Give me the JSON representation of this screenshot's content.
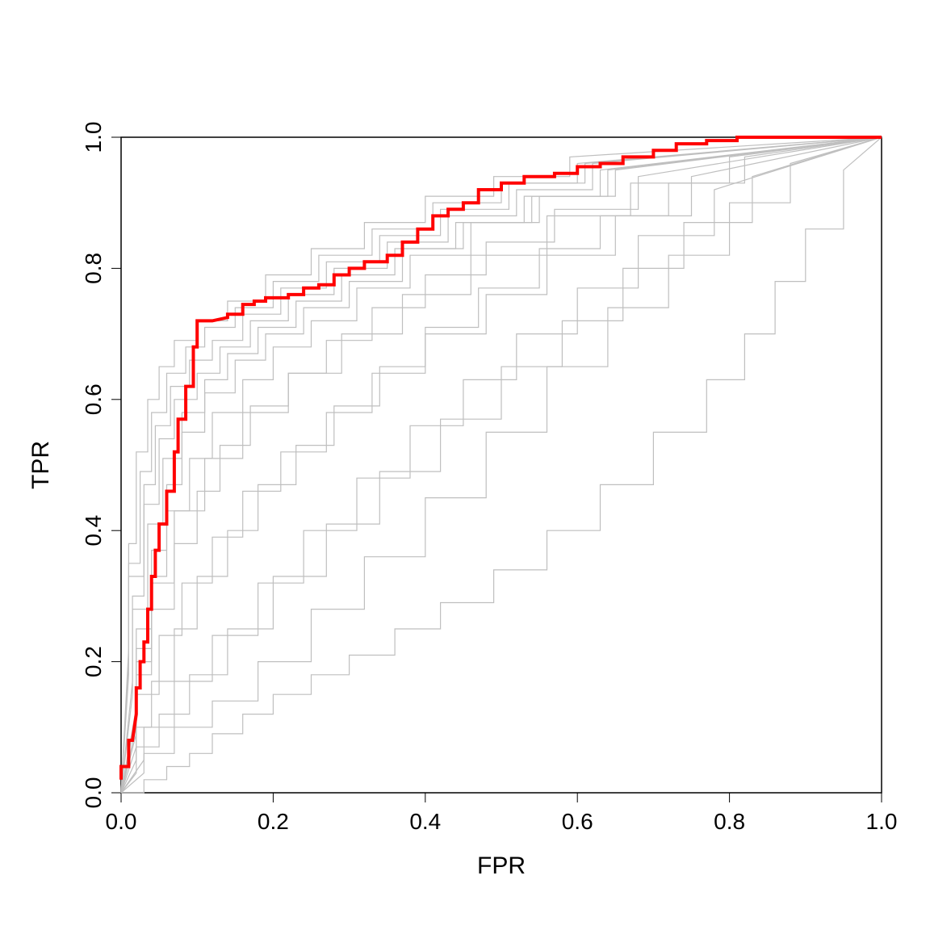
{
  "chart_data": {
    "type": "line",
    "title": "",
    "xlabel": "FPR",
    "ylabel": "TPR",
    "xlim": [
      0.0,
      1.0
    ],
    "ylim": [
      0.0,
      1.0
    ],
    "x_ticks": [
      0.0,
      0.2,
      0.4,
      0.6,
      0.8,
      1.0
    ],
    "y_ticks": [
      0.0,
      0.2,
      0.4,
      0.6,
      0.8,
      1.0
    ],
    "series": [
      {
        "name": "main",
        "color": "#ff0000",
        "lwd": 4,
        "x": [
          0.0,
          0.0,
          0.01,
          0.01,
          0.015,
          0.02,
          0.02,
          0.025,
          0.025,
          0.03,
          0.03,
          0.035,
          0.035,
          0.04,
          0.04,
          0.045,
          0.045,
          0.05,
          0.05,
          0.06,
          0.06,
          0.07,
          0.07,
          0.075,
          0.075,
          0.085,
          0.085,
          0.095,
          0.095,
          0.1,
          0.1,
          0.12,
          0.12,
          0.14,
          0.14,
          0.16,
          0.16,
          0.175,
          0.175,
          0.19,
          0.19,
          0.22,
          0.22,
          0.24,
          0.24,
          0.26,
          0.26,
          0.28,
          0.28,
          0.3,
          0.3,
          0.32,
          0.32,
          0.35,
          0.35,
          0.37,
          0.37,
          0.39,
          0.39,
          0.41,
          0.41,
          0.43,
          0.43,
          0.45,
          0.45,
          0.47,
          0.47,
          0.5,
          0.5,
          0.53,
          0.53,
          0.57,
          0.57,
          0.6,
          0.6,
          0.63,
          0.63,
          0.66,
          0.66,
          0.7,
          0.7,
          0.73,
          0.73,
          0.77,
          0.77,
          0.81,
          0.81,
          1.0
        ],
        "y": [
          0.02,
          0.04,
          0.04,
          0.08,
          0.08,
          0.12,
          0.16,
          0.16,
          0.2,
          0.2,
          0.23,
          0.23,
          0.28,
          0.28,
          0.33,
          0.33,
          0.37,
          0.37,
          0.41,
          0.41,
          0.46,
          0.46,
          0.52,
          0.52,
          0.57,
          0.57,
          0.62,
          0.62,
          0.68,
          0.68,
          0.72,
          0.72,
          0.72,
          0.725,
          0.73,
          0.73,
          0.745,
          0.745,
          0.75,
          0.75,
          0.755,
          0.755,
          0.76,
          0.76,
          0.77,
          0.77,
          0.775,
          0.775,
          0.79,
          0.79,
          0.8,
          0.8,
          0.81,
          0.81,
          0.82,
          0.82,
          0.84,
          0.84,
          0.86,
          0.86,
          0.88,
          0.88,
          0.89,
          0.89,
          0.9,
          0.9,
          0.92,
          0.92,
          0.93,
          0.93,
          0.94,
          0.94,
          0.945,
          0.945,
          0.955,
          0.955,
          0.96,
          0.96,
          0.97,
          0.97,
          0.98,
          0.98,
          0.99,
          0.99,
          0.995,
          0.995,
          1.0,
          1.0
        ]
      },
      {
        "name": "gray-1",
        "color": "#bfbfbf",
        "lwd": 1,
        "x": [
          0.0,
          0.03,
          0.03,
          0.06,
          0.06,
          0.09,
          0.09,
          0.12,
          0.12,
          0.16,
          0.16,
          0.2,
          0.2,
          0.25,
          0.25,
          0.3,
          0.3,
          0.36,
          0.36,
          0.42,
          0.42,
          0.49,
          0.49,
          0.56,
          0.56,
          0.63,
          0.63,
          0.7,
          0.7,
          0.77,
          0.77,
          0.82,
          0.82,
          0.86,
          0.86,
          0.9,
          0.9,
          0.95,
          0.95,
          1.0
        ],
        "y": [
          0.0,
          0.0,
          0.02,
          0.02,
          0.04,
          0.04,
          0.06,
          0.06,
          0.09,
          0.09,
          0.12,
          0.12,
          0.15,
          0.15,
          0.18,
          0.18,
          0.21,
          0.21,
          0.25,
          0.25,
          0.29,
          0.29,
          0.34,
          0.34,
          0.4,
          0.4,
          0.47,
          0.47,
          0.55,
          0.55,
          0.63,
          0.63,
          0.7,
          0.7,
          0.78,
          0.78,
          0.86,
          0.86,
          0.95,
          1.0
        ]
      },
      {
        "name": "gray-2",
        "color": "#bfbfbf",
        "lwd": 1,
        "x": [
          0.0,
          0.03,
          0.03,
          0.07,
          0.07,
          0.12,
          0.12,
          0.18,
          0.18,
          0.25,
          0.25,
          0.32,
          0.32,
          0.4,
          0.4,
          0.48,
          0.48,
          0.56,
          0.56,
          0.64,
          0.64,
          0.72,
          0.72,
          0.8,
          0.8,
          0.88,
          0.88,
          1.0
        ],
        "y": [
          0.0,
          0.03,
          0.06,
          0.06,
          0.1,
          0.1,
          0.14,
          0.14,
          0.2,
          0.2,
          0.28,
          0.28,
          0.36,
          0.36,
          0.45,
          0.45,
          0.55,
          0.55,
          0.65,
          0.65,
          0.74,
          0.74,
          0.82,
          0.82,
          0.9,
          0.9,
          0.96,
          1.0
        ]
      },
      {
        "name": "gray-3",
        "color": "#bfbfbf",
        "lwd": 1,
        "x": [
          0.0,
          0.02,
          0.02,
          0.04,
          0.04,
          0.07,
          0.07,
          0.1,
          0.1,
          0.14,
          0.14,
          0.18,
          0.18,
          0.23,
          0.23,
          0.28,
          0.28,
          0.34,
          0.34,
          0.4,
          0.4,
          0.47,
          0.47,
          0.55,
          0.55,
          0.63,
          0.63,
          0.72,
          0.72,
          0.82,
          0.82,
          1.0
        ],
        "y": [
          0.0,
          0.05,
          0.1,
          0.1,
          0.17,
          0.17,
          0.25,
          0.25,
          0.33,
          0.33,
          0.4,
          0.4,
          0.47,
          0.47,
          0.53,
          0.53,
          0.59,
          0.59,
          0.65,
          0.65,
          0.71,
          0.71,
          0.77,
          0.77,
          0.83,
          0.83,
          0.88,
          0.88,
          0.93,
          0.93,
          0.97,
          1.0
        ]
      },
      {
        "name": "gray-4",
        "color": "#bfbfbf",
        "lwd": 1,
        "x": [
          0.0,
          0.02,
          0.02,
          0.05,
          0.05,
          0.08,
          0.08,
          0.12,
          0.12,
          0.16,
          0.16,
          0.21,
          0.21,
          0.27,
          0.27,
          0.33,
          0.33,
          0.4,
          0.4,
          0.48,
          0.48,
          0.56,
          0.56,
          0.65,
          0.65,
          0.75,
          0.75,
          1.0
        ],
        "y": [
          0.0,
          0.07,
          0.15,
          0.15,
          0.24,
          0.24,
          0.32,
          0.32,
          0.39,
          0.39,
          0.46,
          0.46,
          0.52,
          0.52,
          0.58,
          0.58,
          0.64,
          0.64,
          0.7,
          0.7,
          0.76,
          0.76,
          0.82,
          0.82,
          0.88,
          0.88,
          0.94,
          1.0
        ]
      },
      {
        "name": "gray-5",
        "color": "#bfbfbf",
        "lwd": 1,
        "x": [
          0.0,
          0.02,
          0.02,
          0.04,
          0.04,
          0.07,
          0.07,
          0.1,
          0.1,
          0.13,
          0.13,
          0.17,
          0.17,
          0.22,
          0.22,
          0.27,
          0.27,
          0.33,
          0.33,
          0.4,
          0.4,
          0.48,
          0.48,
          0.57,
          0.57,
          0.68,
          0.68,
          1.0
        ],
        "y": [
          0.0,
          0.09,
          0.18,
          0.18,
          0.28,
          0.28,
          0.38,
          0.38,
          0.46,
          0.46,
          0.53,
          0.53,
          0.59,
          0.59,
          0.64,
          0.64,
          0.69,
          0.69,
          0.74,
          0.74,
          0.79,
          0.79,
          0.84,
          0.84,
          0.89,
          0.89,
          0.94,
          1.0
        ]
      },
      {
        "name": "gray-6",
        "color": "#bfbfbf",
        "lwd": 1,
        "x": [
          0.0,
          0.02,
          0.02,
          0.04,
          0.04,
          0.06,
          0.06,
          0.09,
          0.09,
          0.12,
          0.12,
          0.16,
          0.16,
          0.2,
          0.2,
          0.25,
          0.25,
          0.31,
          0.31,
          0.38,
          0.38,
          0.46,
          0.46,
          0.55,
          0.55,
          0.65,
          0.65,
          1.0
        ],
        "y": [
          0.0,
          0.12,
          0.22,
          0.22,
          0.33,
          0.33,
          0.43,
          0.43,
          0.51,
          0.51,
          0.58,
          0.58,
          0.63,
          0.63,
          0.68,
          0.68,
          0.72,
          0.72,
          0.77,
          0.77,
          0.82,
          0.82,
          0.87,
          0.87,
          0.91,
          0.91,
          0.95,
          1.0
        ]
      },
      {
        "name": "gray-7",
        "color": "#bfbfbf",
        "lwd": 1,
        "x": [
          0.0,
          0.02,
          0.02,
          0.04,
          0.04,
          0.06,
          0.06,
          0.08,
          0.08,
          0.11,
          0.11,
          0.15,
          0.15,
          0.19,
          0.19,
          0.24,
          0.24,
          0.3,
          0.3,
          0.37,
          0.37,
          0.45,
          0.45,
          0.54,
          0.54,
          0.64,
          0.64,
          1.0
        ],
        "y": [
          0.0,
          0.13,
          0.25,
          0.25,
          0.37,
          0.37,
          0.47,
          0.47,
          0.55,
          0.55,
          0.61,
          0.61,
          0.66,
          0.66,
          0.7,
          0.7,
          0.74,
          0.74,
          0.78,
          0.78,
          0.83,
          0.83,
          0.87,
          0.87,
          0.91,
          0.91,
          0.95,
          1.0
        ]
      },
      {
        "name": "gray-8",
        "color": "#bfbfbf",
        "lwd": 1,
        "x": [
          0.0,
          0.015,
          0.015,
          0.035,
          0.035,
          0.055,
          0.055,
          0.08,
          0.08,
          0.11,
          0.11,
          0.14,
          0.14,
          0.18,
          0.18,
          0.23,
          0.23,
          0.29,
          0.29,
          0.36,
          0.36,
          0.44,
          0.44,
          0.53,
          0.53,
          0.63,
          0.63,
          1.0
        ],
        "y": [
          0.0,
          0.15,
          0.28,
          0.28,
          0.41,
          0.41,
          0.51,
          0.51,
          0.58,
          0.58,
          0.63,
          0.63,
          0.67,
          0.67,
          0.71,
          0.71,
          0.75,
          0.75,
          0.79,
          0.79,
          0.83,
          0.83,
          0.87,
          0.87,
          0.91,
          0.91,
          0.95,
          1.0
        ]
      },
      {
        "name": "gray-9",
        "color": "#bfbfbf",
        "lwd": 1,
        "x": [
          0.0,
          0.015,
          0.015,
          0.03,
          0.03,
          0.05,
          0.05,
          0.07,
          0.07,
          0.1,
          0.1,
          0.13,
          0.13,
          0.17,
          0.17,
          0.22,
          0.22,
          0.28,
          0.28,
          0.35,
          0.35,
          0.43,
          0.43,
          0.52,
          0.52,
          0.62,
          0.62,
          1.0
        ],
        "y": [
          0.0,
          0.17,
          0.3,
          0.3,
          0.44,
          0.44,
          0.54,
          0.54,
          0.6,
          0.6,
          0.64,
          0.64,
          0.68,
          0.68,
          0.72,
          0.72,
          0.76,
          0.76,
          0.8,
          0.8,
          0.84,
          0.84,
          0.88,
          0.88,
          0.92,
          0.92,
          0.96,
          1.0
        ]
      },
      {
        "name": "gray-10",
        "color": "#bfbfbf",
        "lwd": 1,
        "x": [
          0.0,
          0.01,
          0.01,
          0.03,
          0.03,
          0.045,
          0.045,
          0.065,
          0.065,
          0.09,
          0.09,
          0.12,
          0.12,
          0.16,
          0.16,
          0.21,
          0.21,
          0.27,
          0.27,
          0.34,
          0.34,
          0.42,
          0.42,
          0.51,
          0.51,
          0.61,
          0.61,
          1.0
        ],
        "y": [
          0.0,
          0.18,
          0.33,
          0.33,
          0.47,
          0.47,
          0.56,
          0.56,
          0.62,
          0.62,
          0.66,
          0.66,
          0.69,
          0.69,
          0.73,
          0.73,
          0.77,
          0.77,
          0.81,
          0.81,
          0.85,
          0.85,
          0.89,
          0.89,
          0.93,
          0.93,
          0.96,
          1.0
        ]
      },
      {
        "name": "gray-low-1",
        "color": "#bfbfbf",
        "lwd": 1,
        "x": [
          0.0,
          0.02,
          0.02,
          0.05,
          0.05,
          0.09,
          0.09,
          0.14,
          0.14,
          0.2,
          0.2,
          0.27,
          0.27,
          0.34,
          0.34,
          0.42,
          0.42,
          0.5,
          0.5,
          0.58,
          0.58,
          0.66,
          0.66,
          0.74,
          0.74,
          0.83,
          0.83,
          1.0
        ],
        "y": [
          0.0,
          0.03,
          0.07,
          0.07,
          0.12,
          0.12,
          0.18,
          0.18,
          0.25,
          0.25,
          0.33,
          0.33,
          0.41,
          0.41,
          0.49,
          0.49,
          0.57,
          0.57,
          0.65,
          0.65,
          0.72,
          0.72,
          0.8,
          0.8,
          0.87,
          0.87,
          0.94,
          1.0
        ]
      },
      {
        "name": "gray-low-2",
        "color": "#bfbfbf",
        "lwd": 1,
        "x": [
          0.0,
          0.03,
          0.03,
          0.07,
          0.07,
          0.12,
          0.12,
          0.18,
          0.18,
          0.24,
          0.24,
          0.31,
          0.31,
          0.38,
          0.38,
          0.45,
          0.45,
          0.52,
          0.52,
          0.6,
          0.6,
          0.68,
          0.68,
          0.78,
          0.78,
          1.0
        ],
        "y": [
          0.0,
          0.05,
          0.1,
          0.1,
          0.17,
          0.17,
          0.24,
          0.24,
          0.32,
          0.32,
          0.4,
          0.4,
          0.48,
          0.48,
          0.56,
          0.56,
          0.63,
          0.63,
          0.7,
          0.7,
          0.77,
          0.77,
          0.85,
          0.85,
          0.92,
          1.0
        ]
      },
      {
        "name": "gray-near-main-1",
        "color": "#bfbfbf",
        "lwd": 1,
        "x": [
          0.0,
          0.01,
          0.01,
          0.025,
          0.025,
          0.04,
          0.04,
          0.06,
          0.06,
          0.085,
          0.085,
          0.11,
          0.11,
          0.15,
          0.15,
          0.2,
          0.2,
          0.26,
          0.26,
          0.33,
          0.33,
          0.41,
          0.41,
          0.5,
          0.5,
          0.6,
          0.6,
          1.0
        ],
        "y": [
          0.0,
          0.2,
          0.35,
          0.35,
          0.49,
          0.49,
          0.58,
          0.58,
          0.64,
          0.64,
          0.68,
          0.68,
          0.71,
          0.71,
          0.74,
          0.74,
          0.78,
          0.78,
          0.82,
          0.82,
          0.86,
          0.86,
          0.9,
          0.9,
          0.93,
          0.93,
          0.96,
          1.0
        ]
      },
      {
        "name": "gray-near-main-2",
        "color": "#bfbfbf",
        "lwd": 1,
        "x": [
          0.0,
          0.01,
          0.01,
          0.02,
          0.02,
          0.035,
          0.035,
          0.05,
          0.05,
          0.07,
          0.07,
          0.1,
          0.1,
          0.14,
          0.14,
          0.19,
          0.19,
          0.25,
          0.25,
          0.32,
          0.32,
          0.4,
          0.4,
          0.49,
          0.49,
          0.59,
          0.59,
          1.0
        ],
        "y": [
          0.0,
          0.22,
          0.38,
          0.38,
          0.52,
          0.52,
          0.6,
          0.6,
          0.65,
          0.65,
          0.69,
          0.69,
          0.72,
          0.72,
          0.75,
          0.75,
          0.79,
          0.79,
          0.83,
          0.83,
          0.87,
          0.87,
          0.91,
          0.91,
          0.94,
          0.94,
          0.97,
          1.0
        ]
      },
      {
        "name": "gray-below-red",
        "color": "#bfbfbf",
        "lwd": 1,
        "x": [
          0.0,
          0.02,
          0.02,
          0.04,
          0.04,
          0.07,
          0.07,
          0.11,
          0.11,
          0.16,
          0.16,
          0.22,
          0.22,
          0.29,
          0.29,
          0.37,
          0.37,
          0.46,
          0.46,
          0.56,
          0.56,
          0.67,
          0.67,
          0.8,
          0.8,
          1.0
        ],
        "y": [
          0.0,
          0.1,
          0.2,
          0.2,
          0.32,
          0.32,
          0.43,
          0.43,
          0.51,
          0.51,
          0.58,
          0.58,
          0.64,
          0.64,
          0.7,
          0.7,
          0.76,
          0.76,
          0.82,
          0.82,
          0.88,
          0.88,
          0.93,
          0.93,
          0.97,
          1.0
        ]
      }
    ]
  }
}
